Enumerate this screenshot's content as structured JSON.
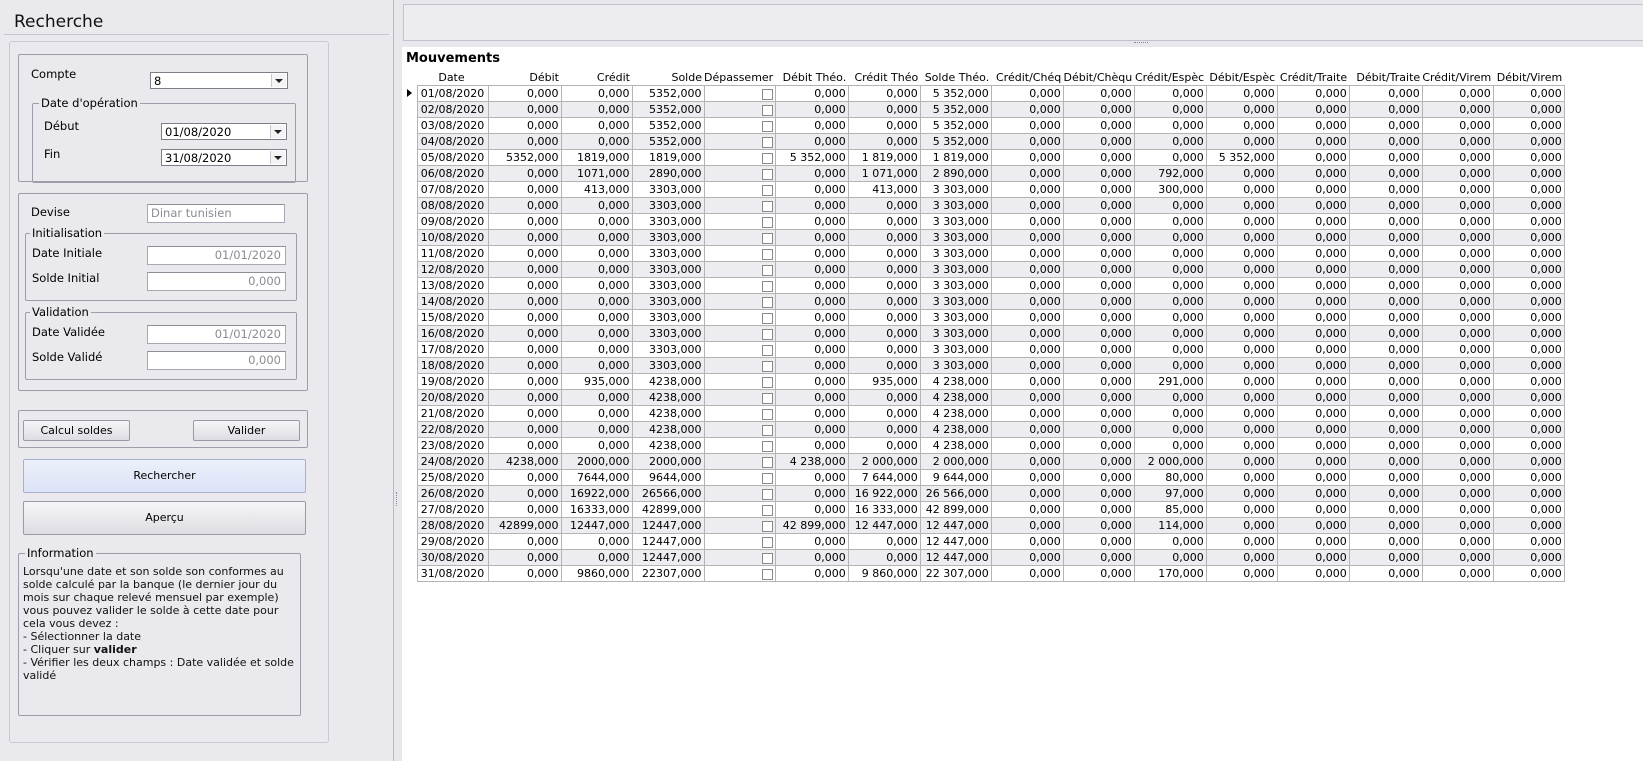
{
  "left": {
    "title": "Recherche",
    "compte_label": "Compte",
    "compte_value": "8",
    "date_group_label": "Date d'opération",
    "debut_label": "Début",
    "debut_value": "01/08/2020",
    "fin_label": "Fin",
    "fin_value": "31/08/2020",
    "devise_label": "Devise",
    "devise_value": "Dinar tunisien",
    "init_group_label": "Initialisation",
    "date_initiale_label": "Date Initiale",
    "date_initiale_value": "01/01/2020",
    "solde_initial_label": "Solde Initial",
    "solde_initial_value": "0,000",
    "validation_group_label": "Validation",
    "date_validee_label": "Date Validée",
    "date_validee_value": "01/01/2020",
    "solde_valide_label": "Solde Validé",
    "solde_valide_value": "0,000",
    "calcul_button": "Calcul soldes",
    "valider_button": "Valider",
    "rechercher_button": "Rechercher",
    "apercu_button": "Aperçu",
    "info_group_label": "Information",
    "info_lines": [
      "Lorsqu'une date et son solde son conformes au",
      "solde calculé par la banque (le dernier jour du",
      "mois sur chaque relevé mensuel par exemple)",
      "vous pouvez valider le solde à cette date pour",
      "cela vous devez :",
      "- Sélectionner la date",
      "- Cliquer sur ",
      "- Vérifier les deux champs : Date validée et solde",
      "validé"
    ],
    "info_bold_word": "valider"
  },
  "grid": {
    "title": "Mouvements",
    "columns": [
      "Date",
      "Débit",
      "Crédit",
      "Solde",
      "Dépassemer",
      "Débit Théo.",
      "Crédit Théo",
      "Solde Théo.",
      "Crédit/Chéq",
      "Débit/Chèqu",
      "Crédit/Espèc",
      "Débit/Espèc",
      "Crédit/Traite",
      "Débit/Traite",
      "Crédit/Virem",
      "Débit/Virem"
    ],
    "rows": [
      [
        "01/08/2020",
        "0,000",
        "0,000",
        "5352,000",
        "",
        "0,000",
        "0,000",
        "5 352,000",
        "0,000",
        "0,000",
        "0,000",
        "0,000",
        "0,000",
        "0,000",
        "0,000",
        "0,000"
      ],
      [
        "02/08/2020",
        "0,000",
        "0,000",
        "5352,000",
        "",
        "0,000",
        "0,000",
        "5 352,000",
        "0,000",
        "0,000",
        "0,000",
        "0,000",
        "0,000",
        "0,000",
        "0,000",
        "0,000"
      ],
      [
        "03/08/2020",
        "0,000",
        "0,000",
        "5352,000",
        "",
        "0,000",
        "0,000",
        "5 352,000",
        "0,000",
        "0,000",
        "0,000",
        "0,000",
        "0,000",
        "0,000",
        "0,000",
        "0,000"
      ],
      [
        "04/08/2020",
        "0,000",
        "0,000",
        "5352,000",
        "",
        "0,000",
        "0,000",
        "5 352,000",
        "0,000",
        "0,000",
        "0,000",
        "0,000",
        "0,000",
        "0,000",
        "0,000",
        "0,000"
      ],
      [
        "05/08/2020",
        "5352,000",
        "1819,000",
        "1819,000",
        "",
        "5 352,000",
        "1 819,000",
        "1 819,000",
        "0,000",
        "0,000",
        "0,000",
        "5 352,000",
        "0,000",
        "0,000",
        "0,000",
        "0,000"
      ],
      [
        "06/08/2020",
        "0,000",
        "1071,000",
        "2890,000",
        "",
        "0,000",
        "1 071,000",
        "2 890,000",
        "0,000",
        "0,000",
        "792,000",
        "0,000",
        "0,000",
        "0,000",
        "0,000",
        "0,000"
      ],
      [
        "07/08/2020",
        "0,000",
        "413,000",
        "3303,000",
        "",
        "0,000",
        "413,000",
        "3 303,000",
        "0,000",
        "0,000",
        "300,000",
        "0,000",
        "0,000",
        "0,000",
        "0,000",
        "0,000"
      ],
      [
        "08/08/2020",
        "0,000",
        "0,000",
        "3303,000",
        "",
        "0,000",
        "0,000",
        "3 303,000",
        "0,000",
        "0,000",
        "0,000",
        "0,000",
        "0,000",
        "0,000",
        "0,000",
        "0,000"
      ],
      [
        "09/08/2020",
        "0,000",
        "0,000",
        "3303,000",
        "",
        "0,000",
        "0,000",
        "3 303,000",
        "0,000",
        "0,000",
        "0,000",
        "0,000",
        "0,000",
        "0,000",
        "0,000",
        "0,000"
      ],
      [
        "10/08/2020",
        "0,000",
        "0,000",
        "3303,000",
        "",
        "0,000",
        "0,000",
        "3 303,000",
        "0,000",
        "0,000",
        "0,000",
        "0,000",
        "0,000",
        "0,000",
        "0,000",
        "0,000"
      ],
      [
        "11/08/2020",
        "0,000",
        "0,000",
        "3303,000",
        "",
        "0,000",
        "0,000",
        "3 303,000",
        "0,000",
        "0,000",
        "0,000",
        "0,000",
        "0,000",
        "0,000",
        "0,000",
        "0,000"
      ],
      [
        "12/08/2020",
        "0,000",
        "0,000",
        "3303,000",
        "",
        "0,000",
        "0,000",
        "3 303,000",
        "0,000",
        "0,000",
        "0,000",
        "0,000",
        "0,000",
        "0,000",
        "0,000",
        "0,000"
      ],
      [
        "13/08/2020",
        "0,000",
        "0,000",
        "3303,000",
        "",
        "0,000",
        "0,000",
        "3 303,000",
        "0,000",
        "0,000",
        "0,000",
        "0,000",
        "0,000",
        "0,000",
        "0,000",
        "0,000"
      ],
      [
        "14/08/2020",
        "0,000",
        "0,000",
        "3303,000",
        "",
        "0,000",
        "0,000",
        "3 303,000",
        "0,000",
        "0,000",
        "0,000",
        "0,000",
        "0,000",
        "0,000",
        "0,000",
        "0,000"
      ],
      [
        "15/08/2020",
        "0,000",
        "0,000",
        "3303,000",
        "",
        "0,000",
        "0,000",
        "3 303,000",
        "0,000",
        "0,000",
        "0,000",
        "0,000",
        "0,000",
        "0,000",
        "0,000",
        "0,000"
      ],
      [
        "16/08/2020",
        "0,000",
        "0,000",
        "3303,000",
        "",
        "0,000",
        "0,000",
        "3 303,000",
        "0,000",
        "0,000",
        "0,000",
        "0,000",
        "0,000",
        "0,000",
        "0,000",
        "0,000"
      ],
      [
        "17/08/2020",
        "0,000",
        "0,000",
        "3303,000",
        "",
        "0,000",
        "0,000",
        "3 303,000",
        "0,000",
        "0,000",
        "0,000",
        "0,000",
        "0,000",
        "0,000",
        "0,000",
        "0,000"
      ],
      [
        "18/08/2020",
        "0,000",
        "0,000",
        "3303,000",
        "",
        "0,000",
        "0,000",
        "3 303,000",
        "0,000",
        "0,000",
        "0,000",
        "0,000",
        "0,000",
        "0,000",
        "0,000",
        "0,000"
      ],
      [
        "19/08/2020",
        "0,000",
        "935,000",
        "4238,000",
        "",
        "0,000",
        "935,000",
        "4 238,000",
        "0,000",
        "0,000",
        "291,000",
        "0,000",
        "0,000",
        "0,000",
        "0,000",
        "0,000"
      ],
      [
        "20/08/2020",
        "0,000",
        "0,000",
        "4238,000",
        "",
        "0,000",
        "0,000",
        "4 238,000",
        "0,000",
        "0,000",
        "0,000",
        "0,000",
        "0,000",
        "0,000",
        "0,000",
        "0,000"
      ],
      [
        "21/08/2020",
        "0,000",
        "0,000",
        "4238,000",
        "",
        "0,000",
        "0,000",
        "4 238,000",
        "0,000",
        "0,000",
        "0,000",
        "0,000",
        "0,000",
        "0,000",
        "0,000",
        "0,000"
      ],
      [
        "22/08/2020",
        "0,000",
        "0,000",
        "4238,000",
        "",
        "0,000",
        "0,000",
        "4 238,000",
        "0,000",
        "0,000",
        "0,000",
        "0,000",
        "0,000",
        "0,000",
        "0,000",
        "0,000"
      ],
      [
        "23/08/2020",
        "0,000",
        "0,000",
        "4238,000",
        "",
        "0,000",
        "0,000",
        "4 238,000",
        "0,000",
        "0,000",
        "0,000",
        "0,000",
        "0,000",
        "0,000",
        "0,000",
        "0,000"
      ],
      [
        "24/08/2020",
        "4238,000",
        "2000,000",
        "2000,000",
        "",
        "4 238,000",
        "2 000,000",
        "2 000,000",
        "0,000",
        "0,000",
        "2 000,000",
        "0,000",
        "0,000",
        "0,000",
        "0,000",
        "0,000"
      ],
      [
        "25/08/2020",
        "0,000",
        "7644,000",
        "9644,000",
        "",
        "0,000",
        "7 644,000",
        "9 644,000",
        "0,000",
        "0,000",
        "80,000",
        "0,000",
        "0,000",
        "0,000",
        "0,000",
        "0,000"
      ],
      [
        "26/08/2020",
        "0,000",
        "16922,000",
        "26566,000",
        "",
        "0,000",
        "16 922,000",
        "26 566,000",
        "0,000",
        "0,000",
        "97,000",
        "0,000",
        "0,000",
        "0,000",
        "0,000",
        "0,000"
      ],
      [
        "27/08/2020",
        "0,000",
        "16333,000",
        "42899,000",
        "",
        "0,000",
        "16 333,000",
        "42 899,000",
        "0,000",
        "0,000",
        "85,000",
        "0,000",
        "0,000",
        "0,000",
        "0,000",
        "0,000"
      ],
      [
        "28/08/2020",
        "42899,000",
        "12447,000",
        "12447,000",
        "",
        "42 899,000",
        "12 447,000",
        "12 447,000",
        "0,000",
        "0,000",
        "114,000",
        "0,000",
        "0,000",
        "0,000",
        "0,000",
        "0,000"
      ],
      [
        "29/08/2020",
        "0,000",
        "0,000",
        "12447,000",
        "",
        "0,000",
        "0,000",
        "12 447,000",
        "0,000",
        "0,000",
        "0,000",
        "0,000",
        "0,000",
        "0,000",
        "0,000",
        "0,000"
      ],
      [
        "30/08/2020",
        "0,000",
        "0,000",
        "12447,000",
        "",
        "0,000",
        "0,000",
        "12 447,000",
        "0,000",
        "0,000",
        "0,000",
        "0,000",
        "0,000",
        "0,000",
        "0,000",
        "0,000"
      ],
      [
        "31/08/2020",
        "0,000",
        "9860,000",
        "22307,000",
        "",
        "0,000",
        "9 860,000",
        "22 307,000",
        "0,000",
        "0,000",
        "170,000",
        "0,000",
        "0,000",
        "0,000",
        "0,000",
        "0,000"
      ]
    ]
  }
}
